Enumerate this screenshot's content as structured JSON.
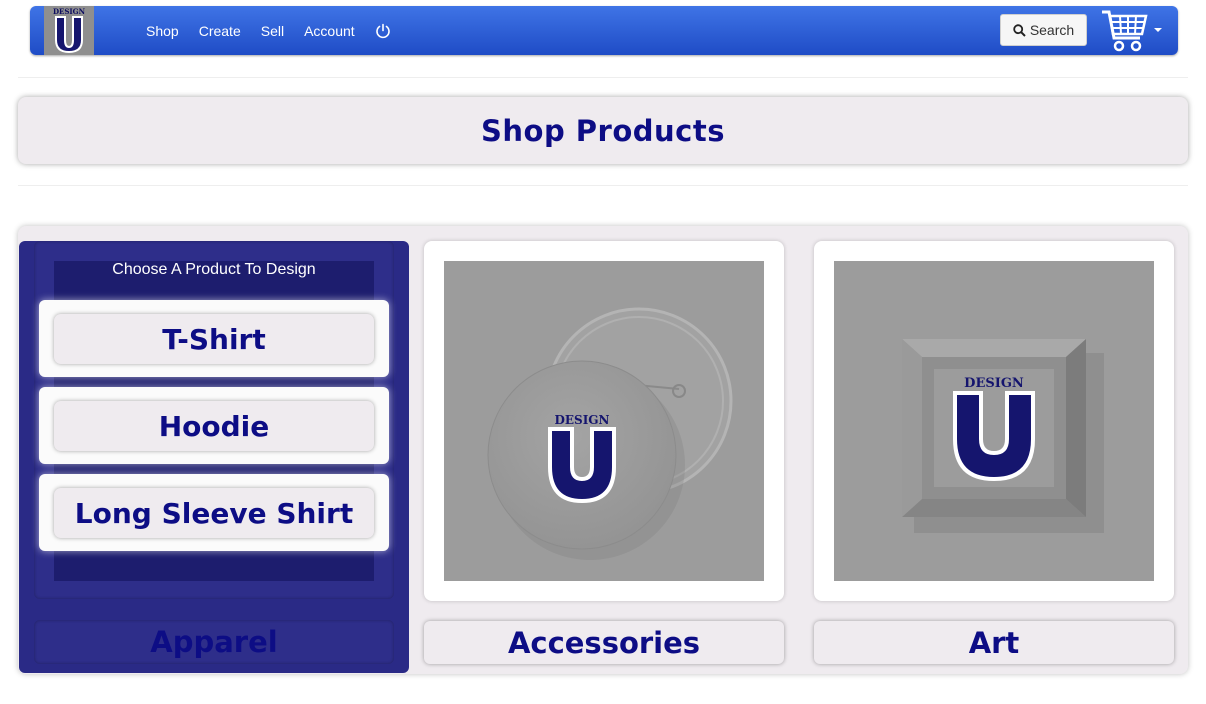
{
  "brand": {
    "logo_top_text": "DESIGN",
    "logo_letter": "U"
  },
  "nav": {
    "links": [
      "Shop",
      "Create",
      "Sell",
      "Account"
    ]
  },
  "search": {
    "label": "Search"
  },
  "page": {
    "title": "Shop Products"
  },
  "apparel": {
    "heading": "Choose A Product To Design",
    "products": [
      "T-Shirt",
      "Hoodie",
      "Long Sleeve Shirt"
    ],
    "label": "Apparel"
  },
  "categories": [
    {
      "label": "Accessories",
      "logo_top_text": "DESIGN",
      "logo_letter": "U"
    },
    {
      "label": "Art",
      "logo_top_text": "DESIGN",
      "logo_letter": "U"
    }
  ],
  "colors": {
    "navy": "#0d0d85",
    "navbar": "#2a5bd8",
    "apparel_bg": "#2a2a86"
  }
}
